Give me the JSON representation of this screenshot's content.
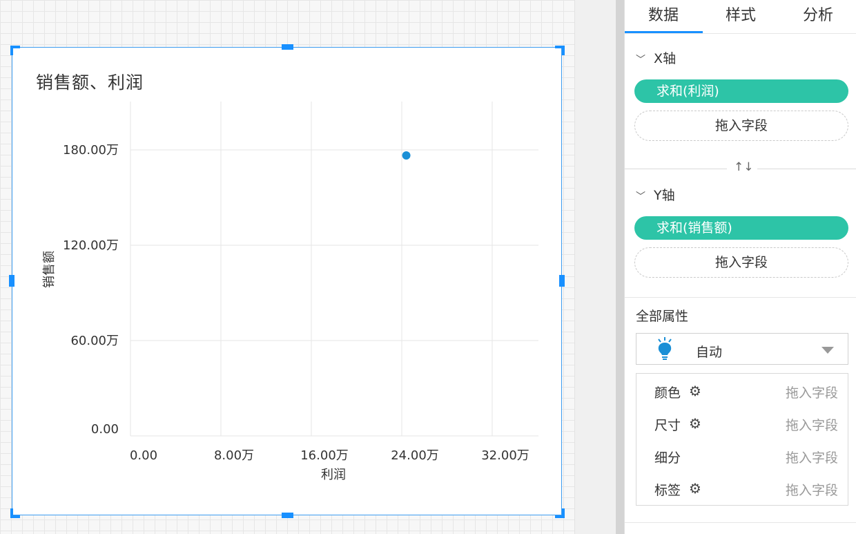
{
  "chart_data": {
    "type": "scatter",
    "title": "销售额、利润",
    "xlabel": "利润",
    "ylabel": "销售额",
    "x_ticks": [
      "0.00",
      "8.00万",
      "16.00万",
      "24.00万",
      "32.00万"
    ],
    "y_ticks": [
      "0.00",
      "60.00万",
      "120.00万",
      "180.00万"
    ],
    "xlim": [
      0,
      360000
    ],
    "ylim": [
      0,
      2100000
    ],
    "grid": true,
    "points": [
      {
        "x": 244000,
        "y": 1765000
      }
    ],
    "color": "#1a8fd6"
  },
  "panel": {
    "tabs": [
      "数据",
      "样式",
      "分析"
    ],
    "x_section": {
      "title": "X轴",
      "field": "求和(利润)",
      "drop": "拖入字段"
    },
    "y_section": {
      "title": "Y轴",
      "field": "求和(销售额)",
      "drop": "拖入字段"
    },
    "swap_icon": "↑↓",
    "all_props": "全部属性",
    "select_value": "自动",
    "props": [
      {
        "label": "颜色",
        "gear": true,
        "drop": "拖入字段"
      },
      {
        "label": "尺寸",
        "gear": true,
        "drop": "拖入字段"
      },
      {
        "label": "细分",
        "gear": false,
        "drop": "拖入字段"
      },
      {
        "label": "标签",
        "gear": true,
        "drop": "拖入字段"
      }
    ]
  },
  "colors": {
    "accent": "#1890ff",
    "pill": "#2dc4a7",
    "point": "#1a8fd6"
  }
}
